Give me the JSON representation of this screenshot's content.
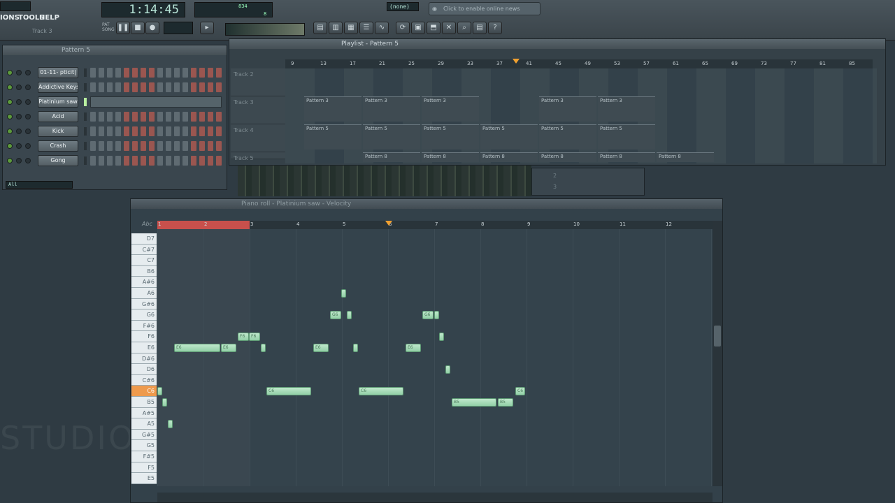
{
  "menu": {
    "items": [
      "IONS",
      "TOOLS",
      "HELP"
    ]
  },
  "transport": {
    "time": "1:14:45",
    "pattern_label": "PAT",
    "song_label": "SONG",
    "tempo_top": "834",
    "tempo_sub": "8"
  },
  "news": {
    "text": "Click to enable online news"
  },
  "none_select": "(none)",
  "hint": "Track 3",
  "channel_rack": {
    "title": "Pattern 5",
    "filter": "All",
    "channels": [
      {
        "name": "01-11- pticit|"
      },
      {
        "name": "Addictive Keys"
      },
      {
        "name": "Platinium saw"
      },
      {
        "name": "Acid"
      },
      {
        "name": "Kick"
      },
      {
        "name": "Crash"
      },
      {
        "name": "Gong"
      }
    ]
  },
  "playlist": {
    "title": "Playlist - Pattern 5",
    "ruler": [
      "9",
      "13",
      "17",
      "21",
      "25",
      "29",
      "33",
      "37",
      "41",
      "45",
      "49",
      "53",
      "57",
      "61",
      "65",
      "69",
      "73",
      "77",
      "81",
      "85"
    ],
    "tracks": [
      "Track 2",
      "Track 3",
      "Track 4",
      "Track 5"
    ],
    "clips_row3": [
      "Pattern 3",
      "Pattern 3",
      "Pattern 3",
      "Pattern 3",
      "Pattern 3"
    ],
    "clips_row4": [
      "Pattern 5",
      "Pattern 5",
      "Pattern 5",
      "Pattern 5",
      "Pattern 5",
      "Pattern 5"
    ],
    "clips_row5": [
      "Pattern 8",
      "Pattern 8",
      "Pattern 8",
      "Pattern 8",
      "Pattern 8",
      "Pattern 8"
    ]
  },
  "piano_roll": {
    "title": "Piano roll - Platinium saw - Velocity",
    "abc": "Abc",
    "ruler": [
      "1",
      "2",
      "3",
      "4",
      "5",
      "6",
      "7",
      "8",
      "9",
      "10",
      "11",
      "12"
    ],
    "keys": [
      "D7",
      "C#7",
      "C7",
      "B6",
      "A#6",
      "A6",
      "G#6",
      "G6",
      "F#6",
      "F6",
      "E6",
      "D#6",
      "D6",
      "C#6",
      "C6",
      "B5",
      "A#5",
      "A5",
      "G#5",
      "G5",
      "F#5",
      "F5",
      "E5"
    ],
    "active_key": "C6",
    "notes": [
      {
        "label": "E6",
        "key": "E6"
      },
      {
        "label": "E6",
        "key": "E6"
      },
      {
        "label": "F6",
        "key": "F6"
      },
      {
        "label": "F6",
        "key": "F6"
      },
      {
        "label": "C6",
        "key": "C6"
      },
      {
        "label": "E6",
        "key": "E6"
      },
      {
        "label": "G6",
        "key": "G6"
      },
      {
        "label": "C6",
        "key": "C6"
      },
      {
        "label": "E6",
        "key": "E6"
      },
      {
        "label": "G6",
        "key": "G6"
      },
      {
        "label": "B5",
        "key": "B5"
      },
      {
        "label": "B5",
        "key": "B5"
      },
      {
        "label": "C6",
        "key": "C6"
      }
    ]
  },
  "mixer": {
    "labels": [
      "2",
      "3"
    ]
  },
  "watermark": "STUDIO"
}
